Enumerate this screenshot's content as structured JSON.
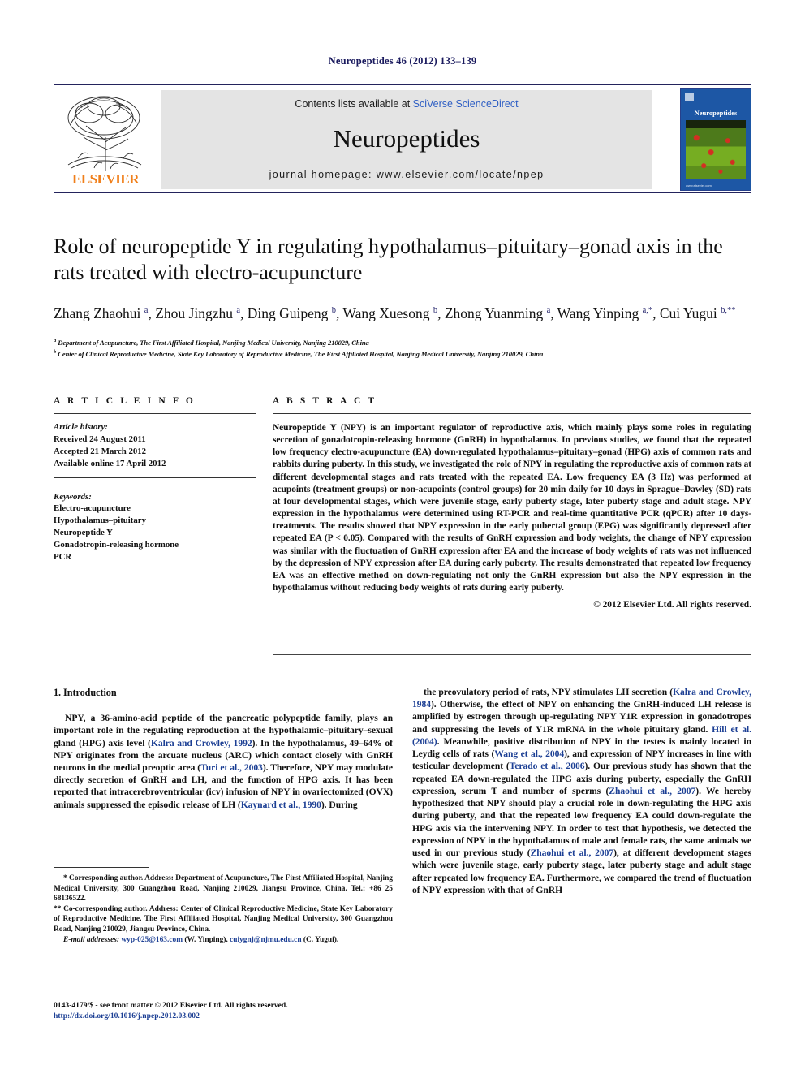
{
  "running_head": "Neuropeptides 46 (2012) 133–139",
  "masthead": {
    "contents_prefix": "Contents lists available at ",
    "sciencedirect": "SciVerse ScienceDirect",
    "journal_title": "Neuropeptides",
    "homepage": "journal homepage: www.elsevier.com/locate/npep",
    "publisher_word": "ELSEVIER",
    "cover_journal_name": "Neuropeptides",
    "cover_caption": "www.elsevier.com"
  },
  "article": {
    "title": "Role of neuropeptide Y in regulating hypothalamus–pituitary–gonad axis in the rats treated with electro-acupuncture",
    "authors_html": "Zhang Zhaohui <sup>a</sup>, Zhou Jingzhu <sup>a</sup>, Ding Guipeng <sup>b</sup>, Wang Xuesong <sup>b</sup>, Zhong Yuanming <sup>a</sup>, Wang Yinping <sup>a,*</sup>, Cui Yugui <sup>b,**</sup>",
    "affiliation_a": "Department of Acupuncture, The First Affiliated Hospital, Nanjing Medical University, Nanjing 210029, China",
    "affiliation_b": "Center of Clinical Reproductive Medicine, State Key Laboratory of Reproductive Medicine, The First Affiliated Hospital, Nanjing Medical University, Nanjing 210029, China"
  },
  "article_info": {
    "heading": "A R T I C L E    I N F O",
    "history_label": "Article history:",
    "received": "Received 24 August 2011",
    "accepted": "Accepted 21 March 2012",
    "available": "Available online 17 April 2012",
    "keywords_label": "Keywords:",
    "keywords": [
      "Electro-acupuncture",
      "Hypothalamus–pituitary",
      "Neuropeptide Y",
      "Gonadotropin-releasing hormone",
      "PCR"
    ]
  },
  "abstract": {
    "heading": "A B S T R A C T",
    "text": "Neuropeptide Y (NPY) is an important regulator of reproductive axis, which mainly plays some roles in regulating secretion of gonadotropin-releasing hormone (GnRH) in hypothalamus. In previous studies, we found that the repeated low frequency electro-acupuncture (EA) down-regulated hypothalamus–pituitary–gonad (HPG) axis of common rats and rabbits during puberty. In this study, we investigated the role of NPY in regulating the reproductive axis of common rats at different developmental stages and rats treated with the repeated EA. Low frequency EA (3 Hz) was performed at acupoints (treatment groups) or non-acupoints (control groups) for 20 min daily for 10 days in Sprague–Dawley (SD) rats at four developmental stages, which were juvenile stage, early puberty stage, later puberty stage and adult stage. NPY expression in the hypothalamus were determined using RT-PCR and real-time quantitative PCR (qPCR) after 10 days-treatments. The results showed that NPY expression in the early pubertal group (EPG) was significantly depressed after repeated EA (P < 0.05). Compared with the results of GnRH expression and body weights, the change of NPY expression was similar with the fluctuation of GnRH expression after EA and the increase of body weights of rats was not influenced by the depression of NPY expression after EA during early puberty. The results demonstrated that repeated low frequency EA was an effective method on down-regulating not only the GnRH expression but also the NPY expression in the hypothalamus without reducing body weights of rats during early puberty.",
    "copyright": "© 2012 Elsevier Ltd. All rights reserved."
  },
  "introduction": {
    "heading": "1. Introduction",
    "left_html": "NPY, a 36-amino-acid peptide of the pancreatic polypeptide family, plays an important role in the regulating reproduction at the hypothalamic–pituitary–sexual gland (HPG) axis level (<span class=\"cite\">Kalra and Crowley, 1992</span>). In the hypothalamus, 49–64% of NPY originates from the arcuate nucleus (ARC) which contact closely with GnRH neurons in the medial preoptic area (<span class=\"cite\">Turi et al., 2003</span>). Therefore, NPY may modulate directly secretion of GnRH and LH, and the function of HPG axis. It has been reported that intracerebroventricular (icv) infusion of NPY in ovariectomized (OVX) animals suppressed the episodic release of LH (<span class=\"cite\">Kaynard et al., 1990</span>). During",
    "right_html": "the preovulatory period of rats, NPY stimulates LH secretion (<span class=\"cite\">Kalra and Crowley, 1984</span>). Otherwise, the effect of NPY on enhancing the GnRH-induced LH release is amplified by estrogen through up-regulating NPY Y1R expression in gonadotropes and suppressing the levels of Y1R mRNA in the whole pituitary gland. <span class=\"cite\">Hill et al. (2004)</span>. Meanwhile, positive distribution of NPY in the testes is mainly located in Leydig cells of rats (<span class=\"cite\">Wang et al., 2004</span>), and expression of NPY increases in line with testicular development (<span class=\"cite\">Terado et al., 2006</span>). Our previous study has shown that the repeated EA down-regulated the HPG axis during puberty, especially the GnRH expression, serum T and number of sperms (<span class=\"cite\">Zhaohui et al., 2007</span>). We hereby hypothesized that NPY should play a crucial role in down-regulating the HPG axis during puberty, and that the repeated low frequency EA could down-regulate the HPG axis via the intervening NPY. In order to test that hypothesis, we detected the expression of NPY in the hypothalamus of male and female rats, the same animals we used in our previous study (<span class=\"cite\">Zhaohui et al., 2007</span>), at different development stages which were juvenile stage, early puberty stage, later puberty stage and adult stage after repeated low frequency EA. Furthermore, we compared the trend of fluctuation of NPY expression with that of GnRH"
  },
  "footnotes": {
    "corresponding_html": "* Corresponding author. Address: Department of Acupuncture, The First Affiliated Hospital, Nanjing Medical University, 300 Guangzhou Road, Nanjing 210029, Jiangsu Province, China. Tel.: +86 25 68136522.",
    "cocorresponding_html": "** Co-corresponding author. Address: Center of Clinical Reproductive Medicine, State Key Laboratory of Reproductive Medicine, The First Affiliated Hospital, Nanjing Medical University, 300 Guangzhou Road, Nanjing 210029, Jiangsu Province, China.",
    "email_label": "E-mail addresses:",
    "email_1": "wyp-025@163.com",
    "email_1_owner": "(W. Yinping)",
    "email_2": "cuiygnj@njmu.edu.cn",
    "email_2_owner": "(C. Yugui)."
  },
  "footer": {
    "issn_line": "0143-4179/$ - see front matter © 2012 Elsevier Ltd. All rights reserved.",
    "doi": "http://dx.doi.org/10.1016/j.npep.2012.03.002"
  },
  "colors": {
    "link_blue": "#1c3f94",
    "header_navy": "#1a1a5e",
    "elsevier_orange": "#f07f1a",
    "cover_blue": "#1d57a5",
    "band_gray": "#e4e4e4"
  }
}
